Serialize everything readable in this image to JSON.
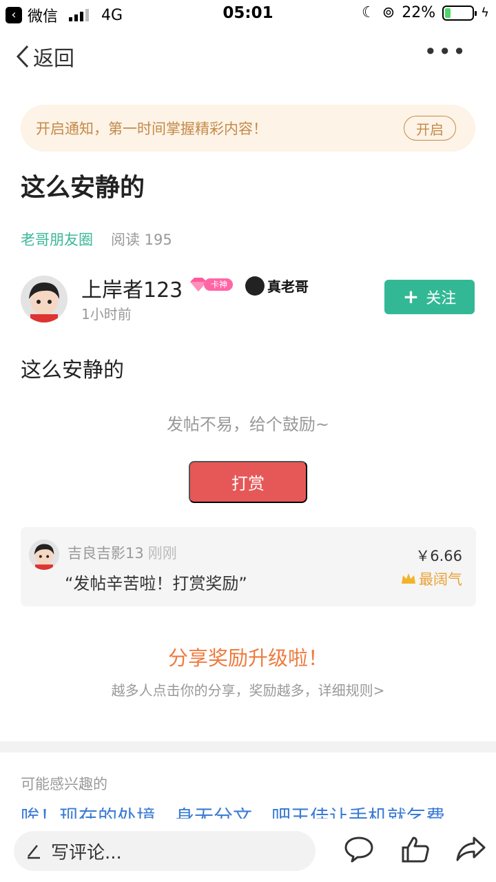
{
  "status_bar": {
    "back_app": "微信",
    "network": "4G",
    "time": "05:01",
    "battery": "22%",
    "battery_level": 0.22
  },
  "nav": {
    "back_label": "返回",
    "more_label": "•••"
  },
  "notify": {
    "text": "开启通知，第一时间掌握精彩内容！",
    "button": "开启"
  },
  "post": {
    "title": "这么安静的",
    "circle": "老哥朋友圈",
    "reads": "阅读 195",
    "author": "上岸者123",
    "badge_level": "卡神",
    "badge_brand": "真老哥",
    "time": "1小时前",
    "follow_label": "关注",
    "body": "这么安静的"
  },
  "reward": {
    "prompt": "发帖不易，给个鼓励~",
    "button": "打赏"
  },
  "tip": {
    "user": "吉良吉影13",
    "time": "刚刚",
    "message": "“发帖辛苦啦！打赏奖励”",
    "amount": "￥6.66",
    "tag": "最阔气"
  },
  "share": {
    "title": "分享奖励升级啦！",
    "subtitle": "越多人点击你的分享，奖励越多，详细规则>"
  },
  "interest": {
    "label": "可能感兴趣的",
    "first_item": "唉！现在的处境，身无分文，吧王佳让手机就乞费"
  },
  "bottom": {
    "comment_placeholder": "写评论..."
  },
  "colors": {
    "accent_green": "#33b895",
    "reward_red": "#e65757",
    "share_orange": "#ef7a3e",
    "notify_bg": "#fdf3e6"
  }
}
